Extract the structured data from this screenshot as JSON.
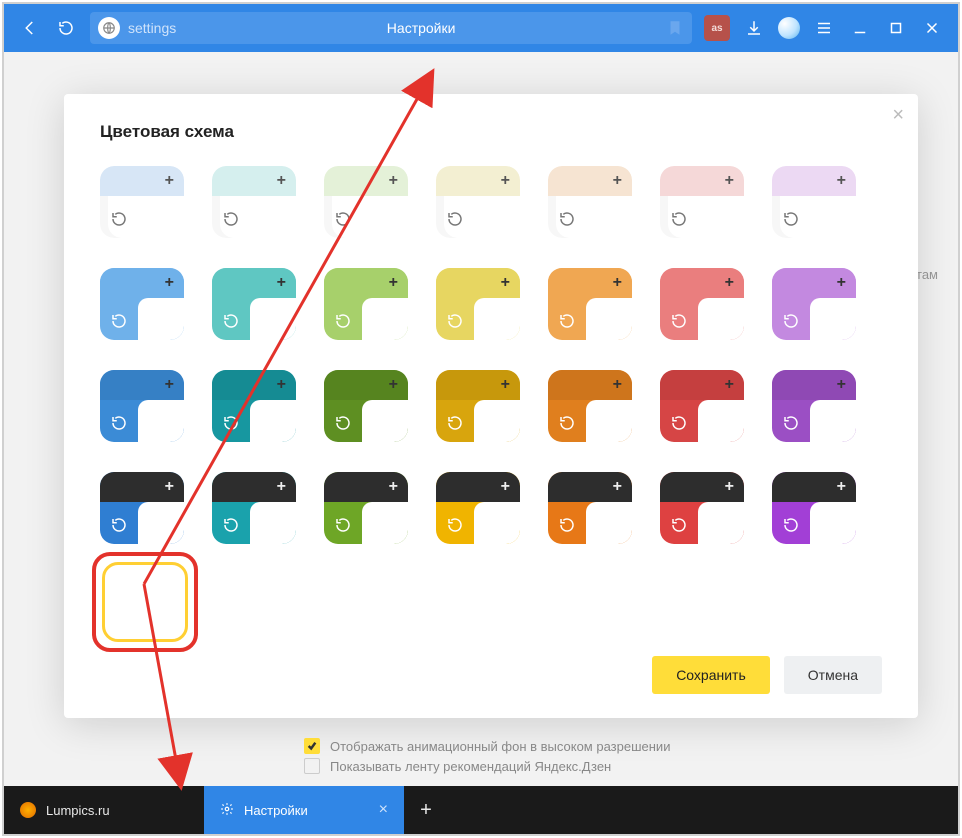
{
  "topbar": {
    "address_path": "settings",
    "page_title": "Настройки",
    "extension_label": "as"
  },
  "modal": {
    "title": "Цветовая схема",
    "save_label": "Сохранить",
    "cancel_label": "Отмена",
    "close_glyph": "×"
  },
  "colors": {
    "hues": [
      "#3b8bd6",
      "#2aa6a0",
      "#7aab3e",
      "#d1b72e",
      "#e07f1e",
      "#d64545",
      "#9b4fc4"
    ],
    "light_tints": [
      "#d7e6f6",
      "#d5efee",
      "#e4f1d8",
      "#f3efd2",
      "#f6e4d2",
      "#f5d8d8",
      "#ecd9f3"
    ],
    "mid_tints": [
      "#6fb1ea",
      "#5fc7c2",
      "#a7d06b",
      "#e7d661",
      "#f0a752",
      "#ea7e7e",
      "#c389e0"
    ],
    "sat": [
      "#3b8bd6",
      "#1797a0",
      "#5e8f22",
      "#d8a50d",
      "#e07f1e",
      "#d64545",
      "#9b4fc4"
    ],
    "dark_body": [
      "#2f7ed2",
      "#1aa2ac",
      "#6ea626",
      "#f0b400",
      "#e77817",
      "#de4141",
      "#a23fd6"
    ]
  },
  "behind": {
    "row1": "Отображать анимационный фон в высоком разрешении",
    "row2": "Показывать ленту рекомендаций Яндекс.Дзен"
  },
  "tabs": {
    "tab1_label": "Lumpics.ru",
    "tab2_label": "Настройки"
  },
  "bg_hint_fragment": "там"
}
